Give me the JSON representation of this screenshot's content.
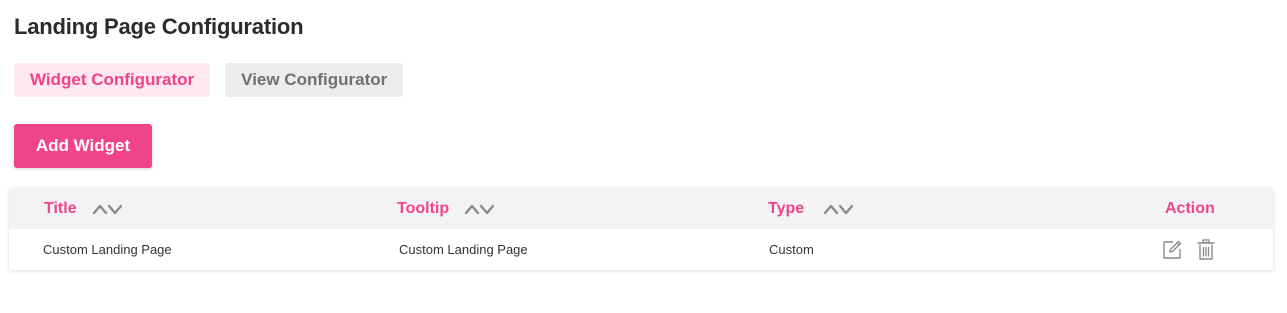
{
  "page": {
    "title": "Landing Page Configuration"
  },
  "tabs": [
    {
      "label": "Widget Configurator",
      "active": true
    },
    {
      "label": "View Configurator",
      "active": false
    }
  ],
  "toolbar": {
    "add_widget_label": "Add Widget"
  },
  "table": {
    "columns": [
      {
        "label": "Title",
        "sortable": true
      },
      {
        "label": "Tooltip",
        "sortable": true
      },
      {
        "label": "Type",
        "sortable": true
      },
      {
        "label": "Action",
        "sortable": false
      }
    ],
    "rows": [
      {
        "title": "Custom Landing Page",
        "tooltip": "Custom Landing Page",
        "type": "Custom",
        "actions": [
          "edit-icon",
          "trash-icon"
        ]
      }
    ]
  },
  "colors": {
    "accent": "#f0448a",
    "accent_light": "#fde8ef",
    "tab_inactive_bg": "#ececec",
    "tab_inactive_text": "#707070",
    "header_bg": "#f3f3f3",
    "title_text": "#2b2b2b",
    "icon_gray": "#8a8a8a"
  }
}
